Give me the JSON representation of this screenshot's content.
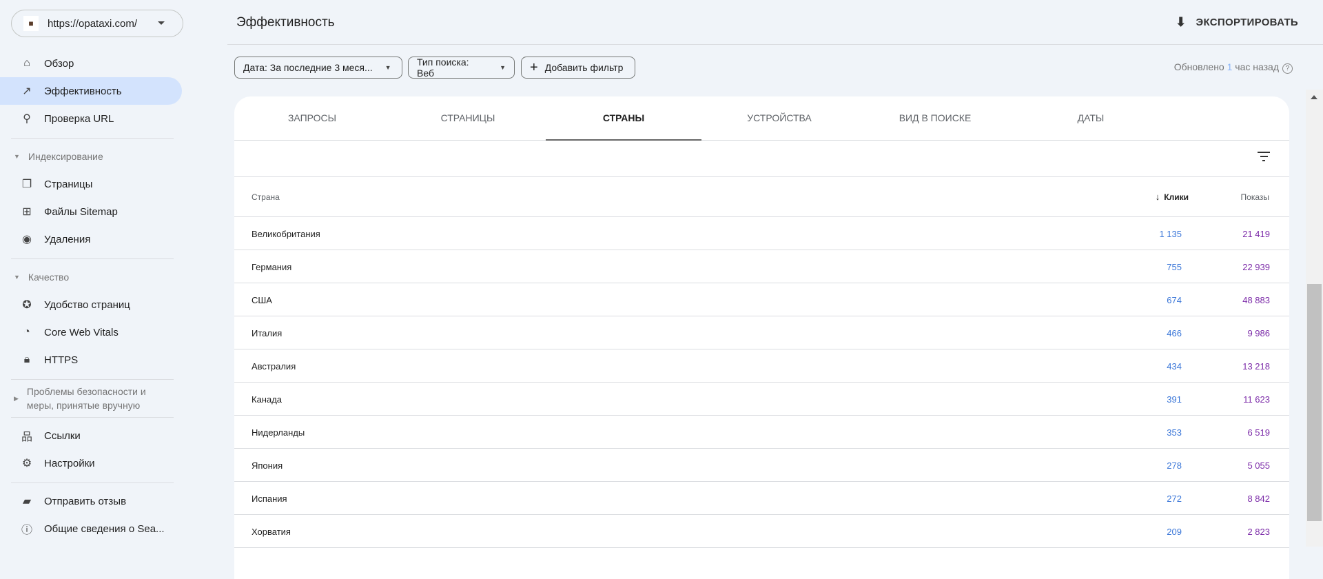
{
  "property": {
    "url": "https://opataxi.com/"
  },
  "sidebar": {
    "items": [
      {
        "label": "Обзор"
      },
      {
        "label": "Эффективность"
      },
      {
        "label": "Проверка URL"
      },
      {
        "label": "Страницы"
      },
      {
        "label": "Файлы Sitemap"
      },
      {
        "label": "Удаления"
      },
      {
        "label": "Удобство страниц"
      },
      {
        "label": "Core Web Vitals"
      },
      {
        "label": "HTTPS"
      },
      {
        "label": "Ссылки"
      },
      {
        "label": "Настройки"
      },
      {
        "label": "Отправить отзыв"
      },
      {
        "label": "Общие сведения о Sea..."
      }
    ],
    "sections": {
      "indexing": "Индексирование",
      "quality": "Качество",
      "security_1": "Проблемы безопасности и",
      "security_2": "меры, принятые вручную"
    }
  },
  "header": {
    "title": "Эффективность",
    "export": "ЭКСПОРТИРОВАТЬ"
  },
  "filters": {
    "date": "Дата: За последние 3 меся...",
    "search_type": "Тип поиска: Веб",
    "add": "Добавить фильтр",
    "updated_prefix": "Обновлено ",
    "updated_value": "1",
    "updated_suffix": " час назад"
  },
  "tabs": [
    "ЗАПРОСЫ",
    "СТРАНИЦЫ",
    "СТРАНЫ",
    "УСТРОЙСТВА",
    "ВИД В ПОИСКЕ",
    "ДАТЫ"
  ],
  "table": {
    "headers": {
      "country": "Страна",
      "clicks": "Клики",
      "impressions": "Показы"
    },
    "rows": [
      {
        "country": "Великобритания",
        "clicks": "1 135",
        "impressions": "21 419"
      },
      {
        "country": "Германия",
        "clicks": "755",
        "impressions": "22 939"
      },
      {
        "country": "США",
        "clicks": "674",
        "impressions": "48 883"
      },
      {
        "country": "Италия",
        "clicks": "466",
        "impressions": "9 986"
      },
      {
        "country": "Австралия",
        "clicks": "434",
        "impressions": "13 218"
      },
      {
        "country": "Канада",
        "clicks": "391",
        "impressions": "11 623"
      },
      {
        "country": "Нидерланды",
        "clicks": "353",
        "impressions": "6 519"
      },
      {
        "country": "Япония",
        "clicks": "278",
        "impressions": "5 055"
      },
      {
        "country": "Испания",
        "clicks": "272",
        "impressions": "8 842"
      },
      {
        "country": "Хорватия",
        "clicks": "209",
        "impressions": "2 823"
      }
    ]
  }
}
